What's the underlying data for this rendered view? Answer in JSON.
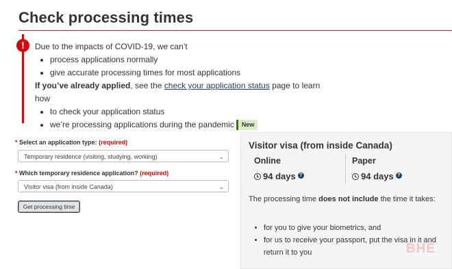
{
  "page": {
    "title": "Check processing times"
  },
  "alert": {
    "intro": "Due to the impacts of COVID-19, we can’t",
    "items1": [
      "process applications normally",
      "give accurate processing times for most applications"
    ],
    "applied_bold": "If you’ve already applied",
    "applied_pre": ", see the ",
    "applied_link": "check your application status",
    "applied_post": " page to learn how",
    "items2": [
      "to check your application status",
      "we’re processing applications during the pandemic"
    ],
    "new_badge": "New"
  },
  "form": {
    "field1": {
      "star": "*",
      "label": "Select an application type:",
      "required": "(required)",
      "value": "Temporary residence (visiting, studying, working)"
    },
    "field2": {
      "star": "*",
      "label": "Which temporary residence application?",
      "required": "(required)",
      "value": "Visitor visa (from inside Canada)"
    },
    "submit_label": "Get processing time"
  },
  "result": {
    "title": "Visitor visa (from inside Canada)",
    "columns": [
      {
        "head": "Online",
        "value": "94 days"
      },
      {
        "head": "Paper",
        "value": "94 days"
      }
    ],
    "desc_pre": "The processing time ",
    "desc_bold": "does not include",
    "desc_post": " the time it takes:",
    "bullets": [
      "for you to give your biometrics, and",
      "for us to receive your passport, put the visa in it and return it to you"
    ]
  },
  "watermark": "BHE",
  "colors": {
    "alert_red": "#d3080c",
    "rule": "#af3c43",
    "link": "#284162",
    "new_bg": "#d8eeca",
    "panel_bg": "#f5f5f5"
  },
  "icons": {
    "alert": "exclamation-circle-icon",
    "clock": "clock-icon",
    "help": "question-circle-icon",
    "chevron": "chevron-down-icon"
  }
}
